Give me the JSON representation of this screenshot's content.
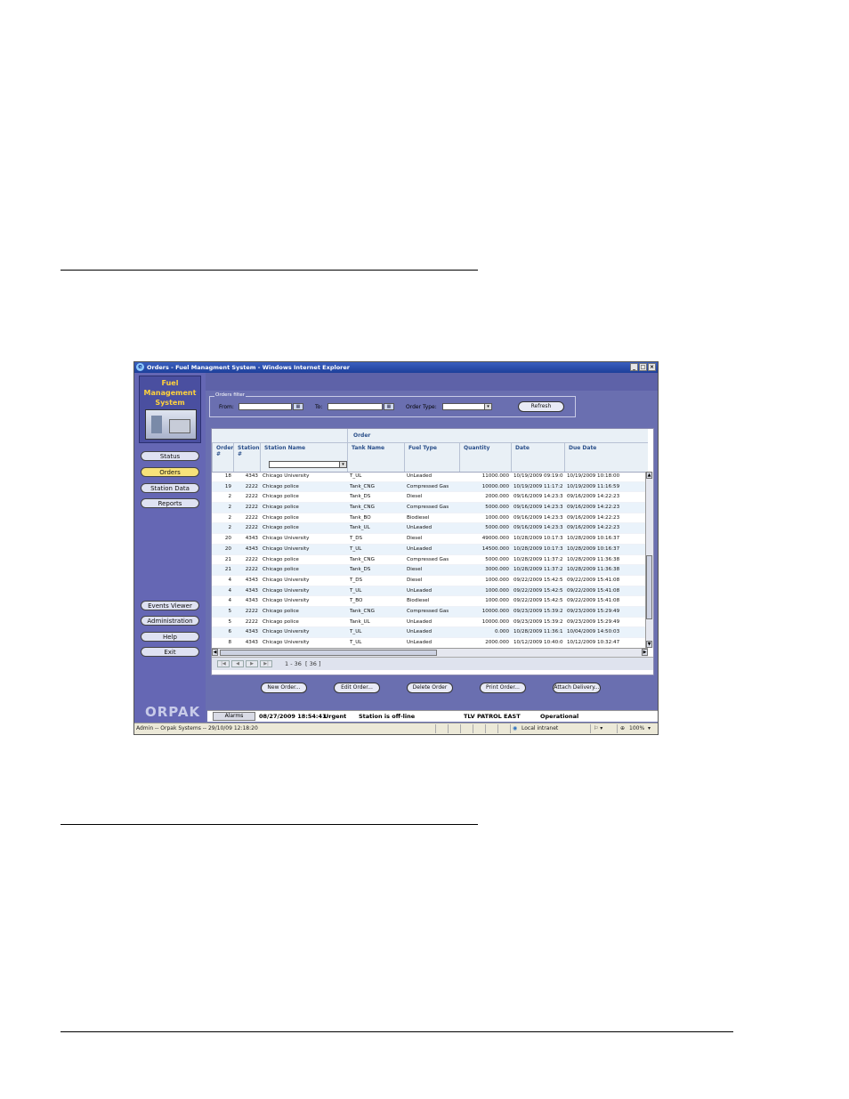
{
  "window": {
    "title": "Orders - Fuel Managment System - Windows Internet Explorer",
    "controls": [
      "_",
      "□",
      "×"
    ]
  },
  "sidebar": {
    "logo_text": "Fuel\nManagement\nSystem",
    "top_items": [
      {
        "label": "Status"
      },
      {
        "label": "Orders"
      },
      {
        "label": "Station Data"
      },
      {
        "label": "Reports"
      }
    ],
    "bottom_items": [
      {
        "label": "Events Viewer"
      },
      {
        "label": "Administration"
      },
      {
        "label": "Help"
      },
      {
        "label": "Exit"
      }
    ],
    "brand": "ORPAK",
    "active": "Orders"
  },
  "filter": {
    "legend": "Orders filter",
    "from_label": "From:",
    "to_label": "To:",
    "type_label": "Order Type:",
    "refresh": "Refresh"
  },
  "grid": {
    "group_label": "Order",
    "columns": [
      "Order #",
      "Station #",
      "Station Name",
      "Tank Name",
      "Fuel Type",
      "Quantity",
      "Date",
      "Due Date"
    ],
    "rows": [
      [
        "18",
        "4343",
        "Chicago University",
        "T_UL",
        "UnLeaded",
        "11000.000",
        "10/19/2009 09:19:0",
        "10/19/2009 10:18:00"
      ],
      [
        "19",
        "2222",
        "Chicago police",
        "Tank_CNG",
        "Compressed Gas",
        "10000.000",
        "10/19/2009 11:17:2",
        "10/19/2009 11:16:59"
      ],
      [
        "2",
        "2222",
        "Chicago police",
        "Tank_DS",
        "Diesel",
        "2000.000",
        "09/16/2009 14:23:3",
        "09/16/2009 14:22:23"
      ],
      [
        "2",
        "2222",
        "Chicago police",
        "Tank_CNG",
        "Compressed Gas",
        "5000.000",
        "09/16/2009 14:23:3",
        "09/16/2009 14:22:23"
      ],
      [
        "2",
        "2222",
        "Chicago police",
        "Tank_BO",
        "Biodiesel",
        "1000.000",
        "09/16/2009 14:23:3",
        "09/16/2009 14:22:23"
      ],
      [
        "2",
        "2222",
        "Chicago police",
        "Tank_UL",
        "UnLeaded",
        "5000.000",
        "09/16/2009 14:23:3",
        "09/16/2009 14:22:23"
      ],
      [
        "20",
        "4343",
        "Chicago University",
        "T_DS",
        "Diesel",
        "49000.000",
        "10/28/2009 10:17:3",
        "10/28/2009 10:16:37"
      ],
      [
        "20",
        "4343",
        "Chicago University",
        "T_UL",
        "UnLeaded",
        "14500.000",
        "10/28/2009 10:17:3",
        "10/28/2009 10:16:37"
      ],
      [
        "21",
        "2222",
        "Chicago police",
        "Tank_CNG",
        "Compressed Gas",
        "5000.000",
        "10/28/2009 11:37:2",
        "10/28/2009 11:36:38"
      ],
      [
        "21",
        "2222",
        "Chicago police",
        "Tank_DS",
        "Diesel",
        "3000.000",
        "10/28/2009 11:37:2",
        "10/28/2009 11:36:38"
      ],
      [
        "4",
        "4343",
        "Chicago University",
        "T_DS",
        "Diesel",
        "1000.000",
        "09/22/2009 15:42:5",
        "09/22/2009 15:41:08"
      ],
      [
        "4",
        "4343",
        "Chicago University",
        "T_UL",
        "UnLeaded",
        "1000.000",
        "09/22/2009 15:42:5",
        "09/22/2009 15:41:08"
      ],
      [
        "4",
        "4343",
        "Chicago University",
        "T_BO",
        "Biodiesel",
        "1000.000",
        "09/22/2009 15:42:5",
        "09/22/2009 15:41:08"
      ],
      [
        "5",
        "2222",
        "Chicago police",
        "Tank_CNG",
        "Compressed Gas",
        "10000.000",
        "09/23/2009 15:39:2",
        "09/23/2009 15:29:49"
      ],
      [
        "5",
        "2222",
        "Chicago police",
        "Tank_UL",
        "UnLeaded",
        "10000.000",
        "09/23/2009 15:39:2",
        "09/23/2009 15:29:49"
      ],
      [
        "6",
        "4343",
        "Chicago University",
        "T_UL",
        "UnLeaded",
        "0.000",
        "10/28/2009 11:36:1",
        "10/04/2009 14:50:03"
      ],
      [
        "8",
        "4343",
        "Chicago University",
        "T_UL",
        "UnLeaded",
        "2000.000",
        "10/12/2009 10:40:0",
        "10/12/2009 10:32:47"
      ]
    ],
    "pager_text": "1 - 36  [ 36 ]"
  },
  "actions": [
    "New Order...",
    "Edit Order...",
    "Delete Order",
    "Print Order...",
    "Attach Delivery..."
  ],
  "alarm_bar": {
    "button": "Alarms",
    "datetime": "08/27/2009 18:54:41",
    "severity": "Urgent",
    "message": "Station is off-line",
    "station": "TLV PATROL EAST",
    "state": "Operational"
  },
  "statusbar": {
    "left": "Admin -- Orpak Systems -- 29/10/09  12:18:20",
    "zone": "Local intranet",
    "zoom": "100%"
  }
}
